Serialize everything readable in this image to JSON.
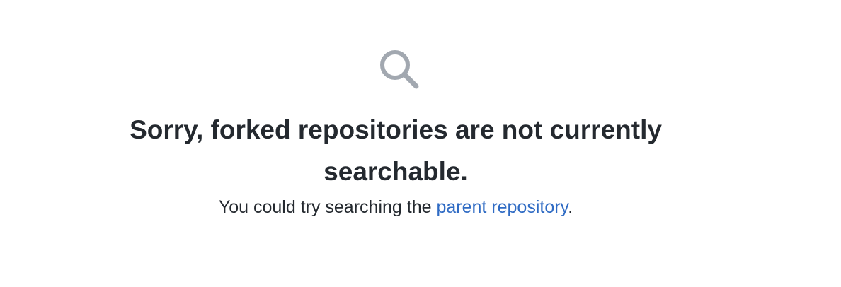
{
  "blankslate": {
    "icon": "search-icon",
    "icon_color": "#a2a8b0",
    "title": "Sorry, forked repositories are not currently searchable.",
    "message_prefix": "You could try searching the ",
    "link_label": "parent repository",
    "message_suffix": ".",
    "text_color": "#24292f",
    "link_color": "#2f6bc4"
  }
}
